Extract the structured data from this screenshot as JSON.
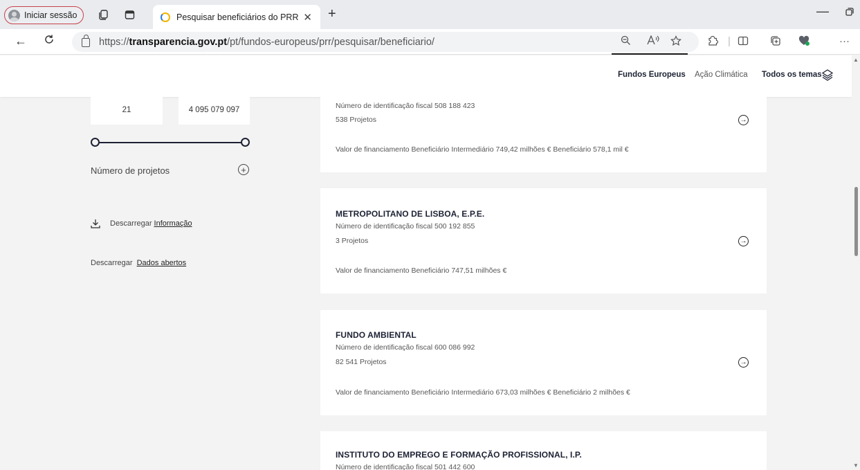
{
  "browser": {
    "profile_label": "Iniciar sessão",
    "tab_title": "Pesquisar beneficiários do PRR",
    "url_prefix": "https://",
    "url_host": "transparencia.gov.pt",
    "url_path": "/pt/fundos-europeus/prr/pesquisar/beneficiario/"
  },
  "header": {
    "nav": [
      "Fundos Europeus",
      "Ação Climática",
      "Todos os temas"
    ]
  },
  "sidebar": {
    "range_min": "21",
    "range_max": "4 095 079 097",
    "filter_label": "Número de projetos",
    "download_prefix": "Descarregar",
    "download_link": "Informação",
    "open_data_prefix": "Descarregar",
    "open_data_link": "Dados abertos"
  },
  "results": [
    {
      "name": "",
      "nif": "Número de identificação fiscal 508 188 423",
      "projects": "538 Projetos",
      "funding": "Valor de financiamento  Beneficiário Intermediário 749,42 milhões €  Beneficiário 578,1 mil €"
    },
    {
      "name": "METROPOLITANO DE LISBOA, E.P.E.",
      "nif": "Número de identificação fiscal 500 192 855",
      "projects": "3 Projetos",
      "funding": "Valor de financiamento  Beneficiário 747,51 milhões €"
    },
    {
      "name": "FUNDO AMBIENTAL",
      "nif": "Número de identificação fiscal 600 086 992",
      "projects": "82 541 Projetos",
      "funding": "Valor de financiamento  Beneficiário Intermediário 673,03 milhões €  Beneficiário 2 milhões €"
    },
    {
      "name": "INSTITUTO DO EMPREGO E FORMAÇÃO PROFISSIONAL, I.P.",
      "nif": "Número de identificação fiscal 501 442 600"
    }
  ]
}
